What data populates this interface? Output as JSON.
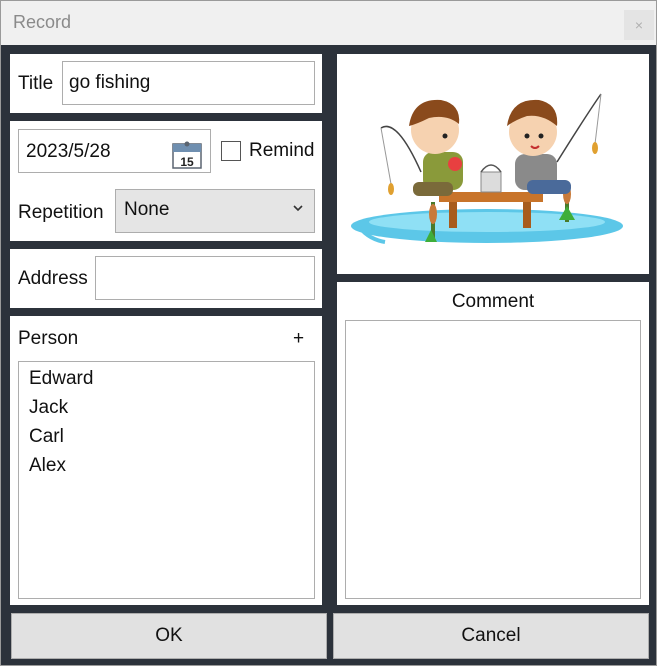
{
  "window": {
    "title": "Record",
    "close_symbol": "×"
  },
  "form": {
    "title_label": "Title",
    "title_value": "go fishing",
    "date_value": "2023/5/28",
    "calendar_day": "15",
    "remind_label": "Remind",
    "remind_checked": false,
    "repetition_label": "Repetition",
    "repetition_value": "None",
    "address_label": "Address",
    "address_value": "",
    "person_label": "Person",
    "person_add": "+",
    "persons": [
      "Edward",
      "Jack",
      "Carl",
      "Alex"
    ],
    "comment_label": "Comment",
    "comment_value": ""
  },
  "buttons": {
    "ok": "OK",
    "cancel": "Cancel"
  },
  "icons": {
    "calendar": "calendar-icon",
    "chevron": "chevron-down-icon",
    "close": "close-icon"
  }
}
